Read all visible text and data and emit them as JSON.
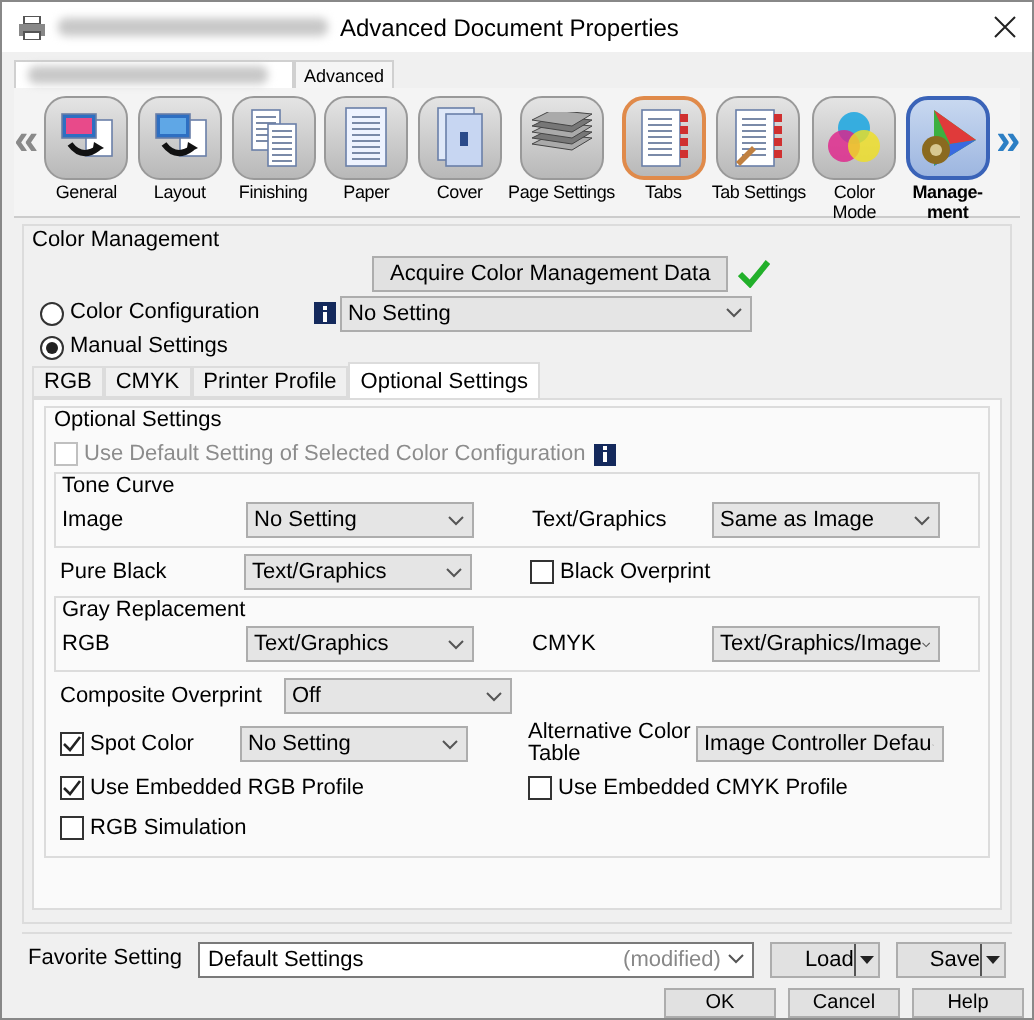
{
  "window": {
    "title": "Advanced Document Properties"
  },
  "tabs": [
    {
      "label": "Advanced",
      "selected": true
    }
  ],
  "toolbar": {
    "scroll_left": "«",
    "scroll_right": "»",
    "items": [
      {
        "label": "General",
        "kind": "general",
        "selected": false,
        "highlighted": false
      },
      {
        "label": "Layout",
        "kind": "layout",
        "selected": false,
        "highlighted": false
      },
      {
        "label": "Finishing",
        "kind": "finishing",
        "selected": false,
        "highlighted": false
      },
      {
        "label": "Paper",
        "kind": "paper",
        "selected": false,
        "highlighted": false
      },
      {
        "label": "Cover",
        "kind": "cover",
        "selected": false,
        "highlighted": false
      },
      {
        "label": "Page Settings",
        "kind": "stack",
        "selected": false,
        "highlighted": false
      },
      {
        "label": "Tabs",
        "kind": "tabs",
        "selected": false,
        "highlighted": true
      },
      {
        "label": "Tab Settings",
        "kind": "tabsettings",
        "selected": false,
        "highlighted": false
      },
      {
        "label": "Color Mode",
        "kind": "colormode",
        "selected": false,
        "highlighted": false
      },
      {
        "label": "Manage-ment",
        "kind": "management",
        "selected": true,
        "highlighted": false
      }
    ]
  },
  "color_management": {
    "title": "Color Management",
    "acquire_button": "Acquire Color Management Data",
    "acquired": true,
    "modes": [
      {
        "label": "Color Configuration",
        "selected": false
      },
      {
        "label": "Manual Settings",
        "selected": true
      }
    ],
    "configuration": {
      "value": "No Setting"
    },
    "subtabs": [
      {
        "label": "RGB",
        "selected": false
      },
      {
        "label": "CMYK",
        "selected": false
      },
      {
        "label": "Printer Profile",
        "selected": false
      },
      {
        "label": "Optional Settings",
        "selected": true
      }
    ],
    "optional": {
      "title": "Optional Settings",
      "use_default": {
        "label": "Use Default Setting of Selected Color Configuration",
        "checked": false,
        "disabled": true
      },
      "tone_curve": {
        "title": "Tone Curve",
        "image": {
          "label": "Image",
          "value": "No Setting"
        },
        "text_graphics": {
          "label": "Text/Graphics",
          "value": "Same as Image"
        }
      },
      "pure_black": {
        "label": "Pure Black",
        "value": "Text/Graphics"
      },
      "black_overprint": {
        "label": "Black Overprint",
        "checked": false
      },
      "gray_replacement": {
        "title": "Gray Replacement",
        "rgb": {
          "label": "RGB",
          "value": "Text/Graphics"
        },
        "cmyk": {
          "label": "CMYK",
          "value": "Text/Graphics/Image"
        }
      },
      "composite_overprint": {
        "label": "Composite Overprint",
        "value": "Off"
      },
      "spot_color": {
        "label": "Spot Color",
        "checked": true,
        "value": "No Setting"
      },
      "alternative_color_table": {
        "label": "Alternative Color Table",
        "value": "Image Controller Defau"
      },
      "embedded_rgb": {
        "label": "Use Embedded RGB Profile",
        "checked": true
      },
      "embedded_cmyk": {
        "label": "Use Embedded CMYK Profile",
        "checked": false
      },
      "rgb_simulation": {
        "label": "RGB Simulation",
        "checked": false
      }
    }
  },
  "favorite": {
    "label": "Favorite Setting",
    "value": "Default Settings",
    "note": "(modified)",
    "load": "Load",
    "save": "Save"
  },
  "buttons": [
    "OK",
    "Cancel",
    "Help"
  ]
}
